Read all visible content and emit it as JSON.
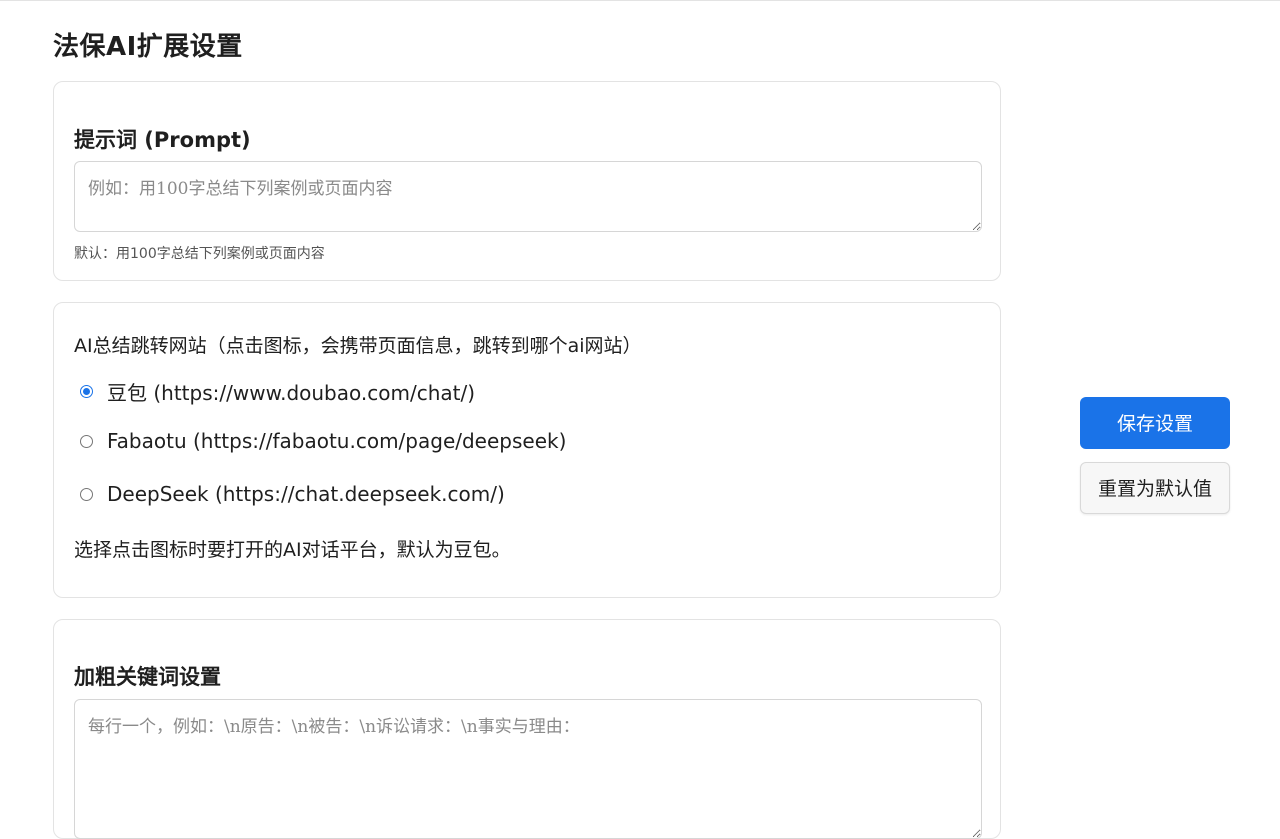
{
  "page": {
    "title": "法保AI扩展设置"
  },
  "prompt_section": {
    "title": "提示词 (Prompt)",
    "placeholder": "例如：用100字总结下列案例或页面内容",
    "value": "",
    "hint": "默认：用100字总结下列案例或页面内容"
  },
  "site_section": {
    "label": "AI总结跳转网站（点击图标，会携带页面信息，跳转到哪个ai网站）",
    "options": [
      {
        "label": "豆包 (https://www.doubao.com/chat/)",
        "selected": true
      },
      {
        "label": "Fabaotu (https://fabaotu.com/page/deepseek)",
        "selected": false
      },
      {
        "label": "DeepSeek (https://chat.deepseek.com/)",
        "selected": false
      }
    ],
    "description": "选择点击图标时要打开的AI对话平台，默认为豆包。"
  },
  "bold_section": {
    "title": "加粗关键词设置",
    "placeholder": "每行一个，例如：\\n原告：\\n被告：\\n诉讼请求：\\n事实与理由：",
    "value": ""
  },
  "actions": {
    "save_label": "保存设置",
    "reset_label": "重置为默认值"
  },
  "colors": {
    "accent": "#1a73e8",
    "border": "#e3e3e3"
  }
}
